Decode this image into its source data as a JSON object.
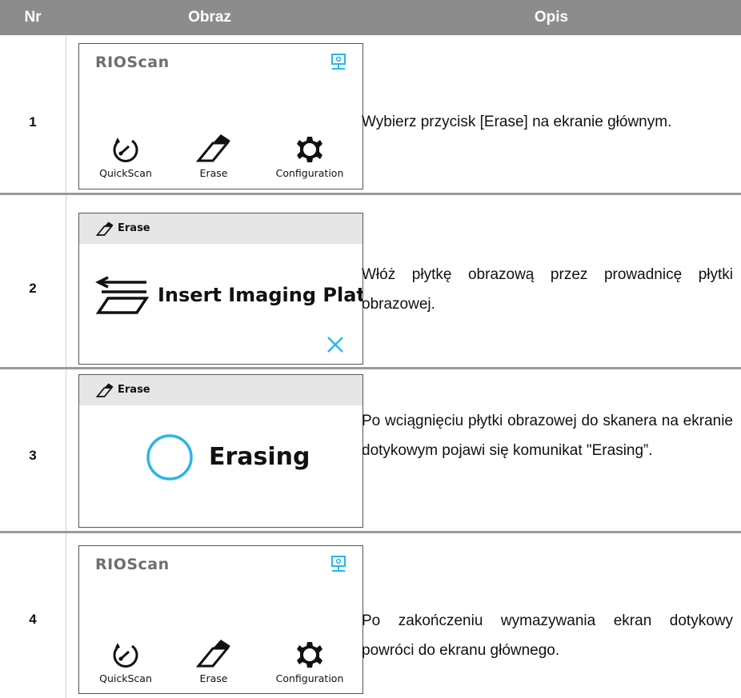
{
  "header": {
    "nr": "Nr",
    "obraz": "Obraz",
    "opis": "Opis"
  },
  "rows": [
    {
      "nr": "1",
      "screen": {
        "brand": "RIOScan",
        "tiles": [
          "QuickScan",
          "Erase",
          "Configuration"
        ]
      },
      "desc": "Wybierz przycisk [Erase] na ekranie głównym."
    },
    {
      "nr": "2",
      "screen": {
        "title": "Erase",
        "message": "Insert Imaging Plate"
      },
      "desc": "Włóż płytkę obrazową przez prowadnicę płytki obrazowej."
    },
    {
      "nr": "3",
      "screen": {
        "title": "Erase",
        "message": "Erasing"
      },
      "desc": "Po wciągnięciu płytki obrazowej do skanera na ekranie dotykowym pojawi się komunikat \"Erasing”."
    },
    {
      "nr": "4",
      "screen": {
        "brand": "RIOScan",
        "tiles": [
          "QuickScan",
          "Erase",
          "Configuration"
        ]
      },
      "desc": "Po zakończeniu wymazywania ekran dotykowy powróci do ekranu głównego."
    }
  ],
  "colors": {
    "header_bg": "#8c8c8c",
    "accent": "#29b6e6",
    "brand_gray": "#6e6e6e"
  },
  "icons": [
    "monitor-network-icon",
    "quickscan-dial-icon",
    "eraser-icon",
    "gear-icon",
    "insert-plate-icon",
    "close-icon",
    "busy-ring-icon"
  ]
}
